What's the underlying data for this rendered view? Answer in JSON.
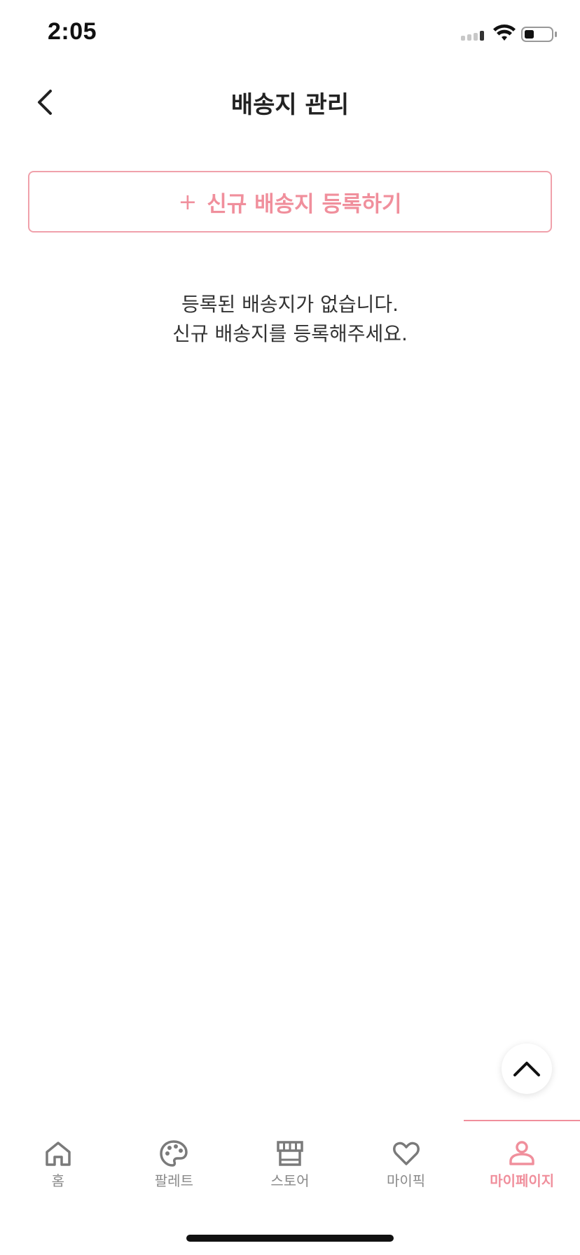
{
  "status_bar": {
    "time": "2:05",
    "icons": [
      "cellular-signal-icon",
      "wifi-icon",
      "battery-icon"
    ]
  },
  "header": {
    "title": "배송지 관리",
    "back_icon": "chevron-left-icon"
  },
  "add_address_button": {
    "plus": "+",
    "label": "신규 배송지 등록하기"
  },
  "empty_state": {
    "line1": "등록된 배송지가 없습니다.",
    "line2": "신규 배송지를 등록해주세요."
  },
  "scroll_top_button": {
    "icon": "chevron-up-icon"
  },
  "tab_bar": {
    "items": [
      {
        "label": "홈",
        "icon": "home-icon"
      },
      {
        "label": "팔레트",
        "icon": "palette-icon"
      },
      {
        "label": "스토어",
        "icon": "store-icon"
      },
      {
        "label": "마이픽",
        "icon": "heart-icon"
      },
      {
        "label": "마이페이지",
        "icon": "person-icon"
      }
    ],
    "active_index": 4
  },
  "colors": {
    "accent": "#f08f9c",
    "tab_inactive": "#8a8a8a",
    "text": "#222222"
  }
}
